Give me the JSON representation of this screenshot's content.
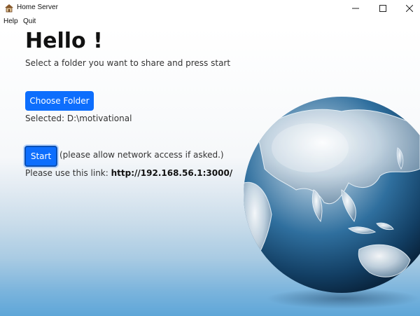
{
  "window": {
    "title": "Home Server",
    "icon": "house-icon",
    "controls": [
      "minimize-icon",
      "maximize-icon",
      "close-icon"
    ]
  },
  "menu": {
    "help": "Help",
    "quit": "Quit"
  },
  "main": {
    "greeting": "Hello !",
    "instruction": "Select a folder you want to share and press start",
    "choose_button": "Choose Folder",
    "selected_label": "Selected: D:\\motivational",
    "start_button": "Start",
    "start_note": "(please allow network access if asked.)",
    "link_prefix": "Please use this link: ",
    "link_url": "http://192.168.56.1:3000/"
  },
  "colors": {
    "accent": "#0d6efd",
    "text": "#111111"
  }
}
